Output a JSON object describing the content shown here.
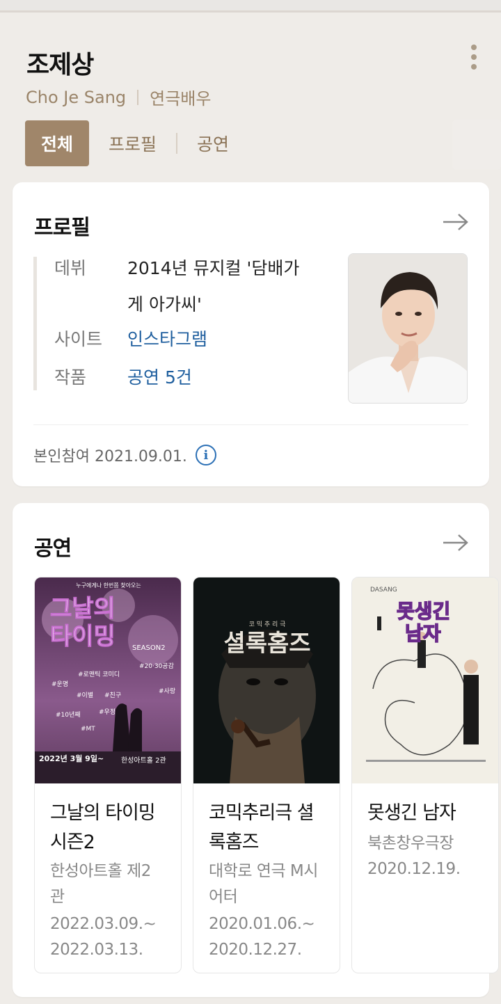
{
  "header": {
    "name": "조제상",
    "name_en": "Cho Je Sang",
    "role": "연극배우",
    "tabs": [
      {
        "label": "전체",
        "active": true
      },
      {
        "label": "프로필",
        "active": false
      },
      {
        "label": "공연",
        "active": false
      }
    ],
    "menu_icon": "more-vertical-icon"
  },
  "profile": {
    "title": "프로필",
    "rows": [
      {
        "key": "데뷔",
        "value_line1": "2014년 뮤지컬 '담배가",
        "value_line2": "게 아가씨'"
      },
      {
        "key": "사이트",
        "value": "인스타그램"
      },
      {
        "key": "작품",
        "value": "공연 5건"
      }
    ],
    "note": "본인참여 2021.09.01.",
    "info_icon": "info-icon"
  },
  "performances": {
    "title": "공연",
    "items": [
      {
        "title_l1": "그날의 타이밍",
        "title_l2": "시즌2",
        "venue_l1": "한성아트홀 제2",
        "venue_l2": "관",
        "date_l1": "2022.03.09.~",
        "date_l2": "2022.03.13.",
        "poster": {
          "headline_l1": "그날의",
          "headline_l2": "타이밍",
          "season": "SEASON2",
          "tagline": "누구에게나 한번쯤 찾아오는",
          "tags": [
            "#로맨틱 코미디",
            "#20·30공감",
            "#운명",
            "#이별",
            "#친구",
            "#사랑",
            "#10년째",
            "#우정",
            "#MT"
          ],
          "date": "2022년 3월 9일~",
          "place": "한성아트홀 2관"
        }
      },
      {
        "title_l1": "코믹추리극 셜",
        "title_l2": "록홈즈",
        "venue_l1": "대학로 연극 M시",
        "venue_l2": "어터",
        "date_l1": "2020.01.06.~",
        "date_l2": "2020.12.27.",
        "poster": {
          "kicker": "코 믹 추 리 극",
          "headline": "셜록홈즈"
        }
      },
      {
        "title_l1": "못생긴 남자",
        "venue_l1": "북촌창우극장",
        "date_l1": "2020.12.19.",
        "poster": {
          "brand": "DASANG",
          "headline_l1": "못생긴",
          "headline_l2": "남자"
        }
      }
    ]
  },
  "colors": {
    "accent": "#a0866a",
    "link": "#1e5e9e",
    "background": "#efece8"
  }
}
